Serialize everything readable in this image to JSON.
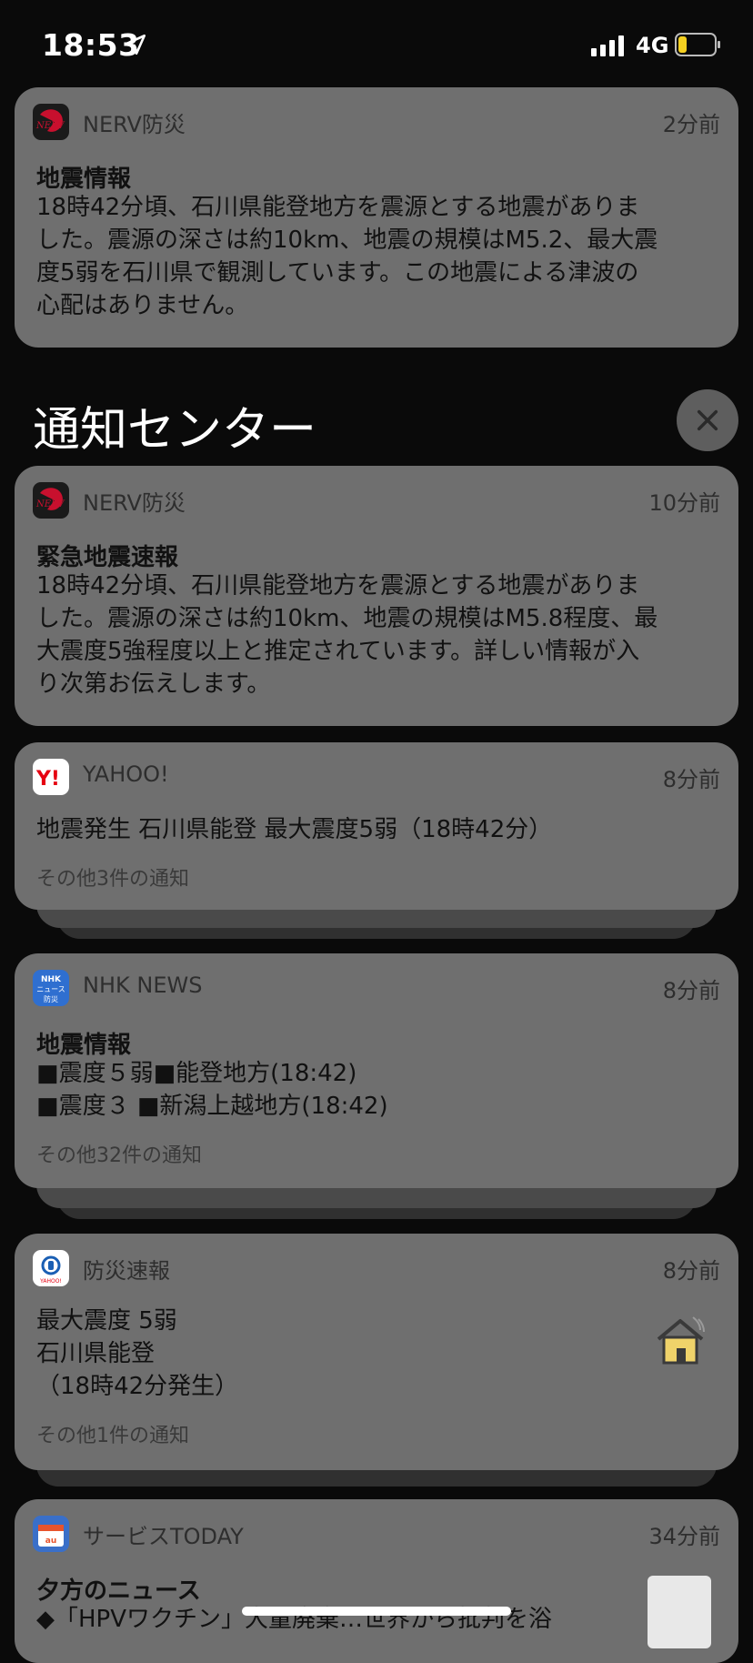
{
  "status_bar": {
    "time": "18:53",
    "network": "4G"
  },
  "notification_center": {
    "title": "通知センター"
  },
  "pinned": {
    "app": "NERV防災",
    "time": "2分前",
    "title": "地震情報",
    "body": [
      "18時42分頃、石川県能登地方を震源とする地震がありま",
      "した。震源の深さは約10km、地震の規模はM5.2、最大震",
      "度5弱を石川県で観測しています。この地震による津波の",
      "心配はありません。"
    ]
  },
  "notifications": [
    {
      "app": "NERV防災",
      "time": "10分前",
      "title": "緊急地震速報",
      "body": [
        "18時42分頃、石川県能登地方を震源とする地震がありま",
        "した。震源の深さは約10km、地震の規模はM5.8程度、最",
        "大震度5強程度以上と推定されています。詳しい情報が入",
        "り次第お伝えします。"
      ]
    },
    {
      "app": "YAHOO!",
      "time": "8分前",
      "body": [
        "地震発生 石川県能登 最大震度5弱（18時42分）"
      ],
      "more": "その他3件の通知"
    },
    {
      "app": "NHK NEWS",
      "time": "8分前",
      "title": "地震情報",
      "body": [
        "■震度５弱■能登地方(18:42)",
        "■震度３ ■新潟上越地方(18:42)"
      ],
      "more": "その他32件の通知"
    },
    {
      "app": "防災速報",
      "time": "8分前",
      "body": [
        "最大震度 5弱",
        "石川県能登",
        "（18時42分発生）"
      ],
      "more": "その他1件の通知"
    },
    {
      "app": "サービスTODAY",
      "time": "34分前",
      "title": "夕方のニュース",
      "body": [
        "◆「HPVワクチン」大量廃棄…世界から批判を浴"
      ]
    }
  ],
  "icons": {
    "nerv": "nerv-logo-icon",
    "yahoo": "yahoo-logo-icon",
    "nhk": "nhk-news-icon",
    "bousai": "bousai-sokuhou-icon",
    "service": "service-today-icon",
    "house": "house-shaking-icon"
  },
  "colors": {
    "card_bg": "#6f6f6f",
    "page_bg": "#0a0a0a",
    "nerv_red": "#c8102e",
    "nhk_blue": "#2f6fd0"
  }
}
